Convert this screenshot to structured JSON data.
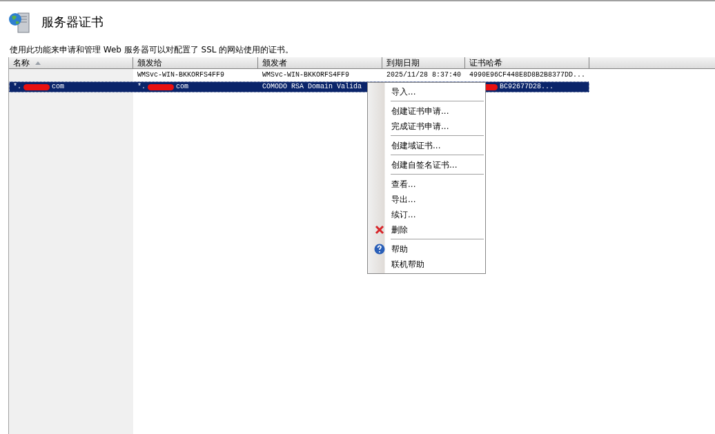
{
  "page": {
    "title": "服务器证书",
    "description": "使用此功能来申请和管理 Web 服务器可以对配置了 SSL 的网站使用的证书。"
  },
  "table": {
    "columns": [
      {
        "label": "名称",
        "sorted": true
      },
      {
        "label": "颁发给",
        "sorted": false
      },
      {
        "label": "颁发者",
        "sorted": false
      },
      {
        "label": "到期日期",
        "sorted": false
      },
      {
        "label": "证书哈希",
        "sorted": false
      }
    ],
    "rows": [
      {
        "selected": false,
        "cells": [
          {
            "text": ""
          },
          {
            "text": "WMSvc-WIN-BKKORFS4FF9"
          },
          {
            "text": "WMSvc-WIN-BKKORFS4FF9"
          },
          {
            "text": "2025/11/28 8:37:40"
          },
          {
            "text": "4990E96CF448E8D8B2B8377DD..."
          }
        ]
      },
      {
        "selected": true,
        "cells": [
          {
            "text": "*.",
            "after": "com"
          },
          {
            "text": "*.",
            "after": "com"
          },
          {
            "text": "COMODO RSA Domain Valida"
          },
          {
            "text": ""
          },
          {
            "text": "",
            "after": "BC92677D28..."
          }
        ]
      }
    ]
  },
  "context_menu": {
    "groups": [
      [
        {
          "label": "导入...",
          "kind": "plain"
        }
      ],
      [
        {
          "label": "创建证书申请...",
          "kind": "plain"
        },
        {
          "label": "完成证书申请...",
          "kind": "plain"
        }
      ],
      [
        {
          "label": "创建域证书...",
          "kind": "plain"
        }
      ],
      [
        {
          "label": "创建自签名证书...",
          "kind": "plain"
        }
      ],
      [
        {
          "label": "查看...",
          "kind": "plain"
        },
        {
          "label": "导出...",
          "kind": "plain"
        },
        {
          "label": "续订...",
          "kind": "plain"
        },
        {
          "label": "删除",
          "kind": "delete"
        }
      ],
      [
        {
          "label": "帮助",
          "kind": "help"
        },
        {
          "label": "联机帮助",
          "kind": "plain"
        }
      ]
    ]
  }
}
